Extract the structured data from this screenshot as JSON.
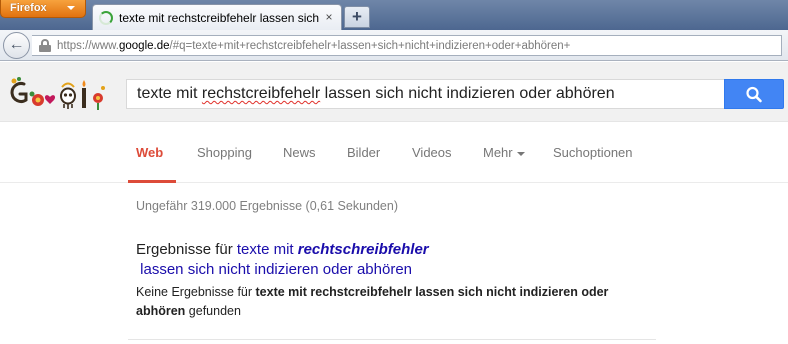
{
  "browser": {
    "menu_label": "Firefox",
    "tab_title": "texte mit rechstcreibfehelr lassen sich nicht i...",
    "tab_close": "×",
    "new_tab": "+",
    "back": "←",
    "url_prefix": "https://www.",
    "url_host": "google.de",
    "url_rest": "/#q=texte+mit+rechstcreibfehelr+lassen+sich+nicht+indizieren+oder+abhören+"
  },
  "search": {
    "query_before": "texte mit ",
    "query_misspelled": "rechstcreibfehelr",
    "query_after": " lassen sich nicht indizieren oder abhören",
    "button_icon": "search-icon"
  },
  "tabs": {
    "web": "Web",
    "shopping": "Shopping",
    "news": "News",
    "images": "Bilder",
    "videos": "Videos",
    "more": "Mehr",
    "options": "Suchoptionen"
  },
  "results": {
    "stats": "Ungefähr 319.000 Ergebnisse (0,61 Sekunden)",
    "showing_prefix": "Ergebnisse für ",
    "corrected_before": "texte mit ",
    "corrected_word": "rechtschreibfehler",
    "corrected_after": " lassen sich nicht indizieren oder abhören",
    "none_prefix": "Keine Ergebnisse für ",
    "none_query": "texte mit rechstcreibfehelr lassen sich nicht indizieren oder abhören",
    "none_suffix": " gefunden"
  },
  "colors": {
    "accent_red": "#dd4b39",
    "link_blue": "#1a0dab",
    "search_blue": "#4285f4",
    "firefox_orange": "#e1720f"
  }
}
